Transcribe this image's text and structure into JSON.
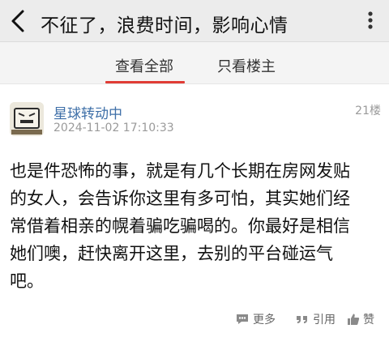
{
  "header": {
    "title": "不征了，浪费时间，影响心情"
  },
  "tabs": [
    {
      "label": "查看全部",
      "active": true
    },
    {
      "label": "只看楼主",
      "active": false
    }
  ],
  "post": {
    "username": "星球转动中",
    "timestamp": "2024-11-02 17:10:33",
    "floor": "21楼",
    "content_lines": [
      "也是件恐怖的事，就是有几个长期在房网发贴",
      "的女人，会告诉你这里有多可怕，其实她们经",
      "常借着相亲的幌着骗吃骗喝的。你最好是相信",
      "她们噢，赶快离开这里，去别的平台碰运气",
      "吧。"
    ],
    "actions": {
      "more_label": "更多",
      "quote_label": "引用",
      "like_label": "赞"
    }
  },
  "colors": {
    "accent": "#e03c35",
    "username": "#3e6fa8",
    "meta": "#9a9a9a"
  }
}
